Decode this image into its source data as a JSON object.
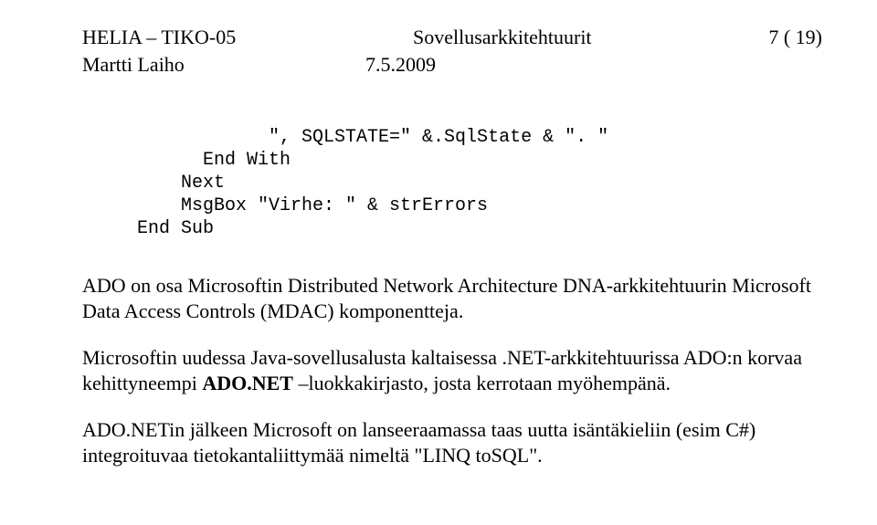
{
  "header": {
    "left": "HELIA – TIKO-05",
    "center": "Sovellusarkkitehtuurit",
    "right": "7 ( 19)"
  },
  "subheader": {
    "author": "Martti Laiho",
    "date": "7.5.2009"
  },
  "code": {
    "line1": "            \", SQLSTATE=\" &.SqlState & \". \"",
    "line2": "      End With",
    "line3": "    Next",
    "line4": "    MsgBox \"Virhe: \" & strErrors",
    "line5": "End Sub"
  },
  "para1": "ADO on osa Microsoftin Distributed Network Architecture DNA-arkkitehtuurin Microsoft Data Access Controls (MDAC) komponentteja.",
  "para2_plain1": "Microsoftin uudessa Java-sovellusalusta kaltaisessa .NET-arkkitehtuurissa ADO:n korvaa kehittyneempi ",
  "para2_bold": "ADO.NET",
  "para2_plain2": " –luokkakirjasto, josta kerrotaan myöhempänä.",
  "para3": "ADO.NETin jälkeen Microsoft on lanseeraamassa taas uutta isäntäkieliin (esim C#) integroituvaa tietokantaliittymää nimeltä \"LINQ toSQL\"."
}
